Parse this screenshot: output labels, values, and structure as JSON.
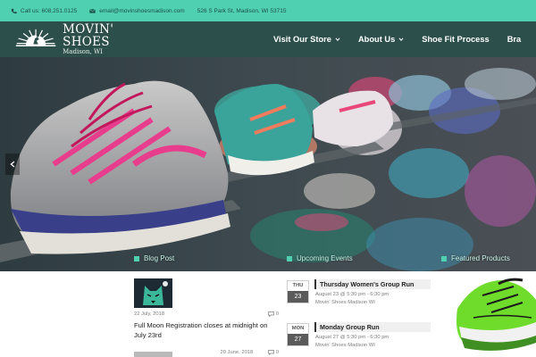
{
  "topbar": {
    "phone": "Call us: 608.251.0125",
    "email": "email@movinshoesmadison.com",
    "address": "526 S Park St, Madison, WI 53715"
  },
  "brand": {
    "title": "MOVIN' SHOES",
    "subtitle": "Madison, WI"
  },
  "nav": {
    "items": [
      {
        "label": "Visit Our Store",
        "dropdown": true
      },
      {
        "label": "About Us",
        "dropdown": true
      },
      {
        "label": "Shoe Fit Process",
        "dropdown": false
      },
      {
        "label": "Bra",
        "dropdown": false
      }
    ]
  },
  "sections": {
    "tabs": [
      "Blog Post",
      "Upcoming Events",
      "Featured Products"
    ]
  },
  "news": {
    "post1": {
      "date": "22 July, 2018",
      "comments": "0",
      "title": "Full Moon Registration closes at midnight on July 23rd"
    },
    "post2": {
      "date": "20 June, 2018",
      "comments": "0"
    }
  },
  "events": [
    {
      "month": "THU",
      "day": "23",
      "title": "Thursday Women's Group Run",
      "time": "August 23 @ 5:30 pm - 6:30 pm",
      "location": "Movin' Shoes Madison WI"
    },
    {
      "month": "MON",
      "day": "27",
      "title": "Monday Group Run",
      "time": "August 27 @ 5:30 pm - 6:30 pm",
      "location": "Movin' Shoes Madison WI"
    }
  ],
  "colors": {
    "accent": "#4fd1b1",
    "header": "#2d4f4b"
  },
  "icons": {
    "phone": "phone-icon",
    "email": "envelope-icon",
    "slider_prev": "chevron-left-icon",
    "comments": "comment-icon"
  }
}
